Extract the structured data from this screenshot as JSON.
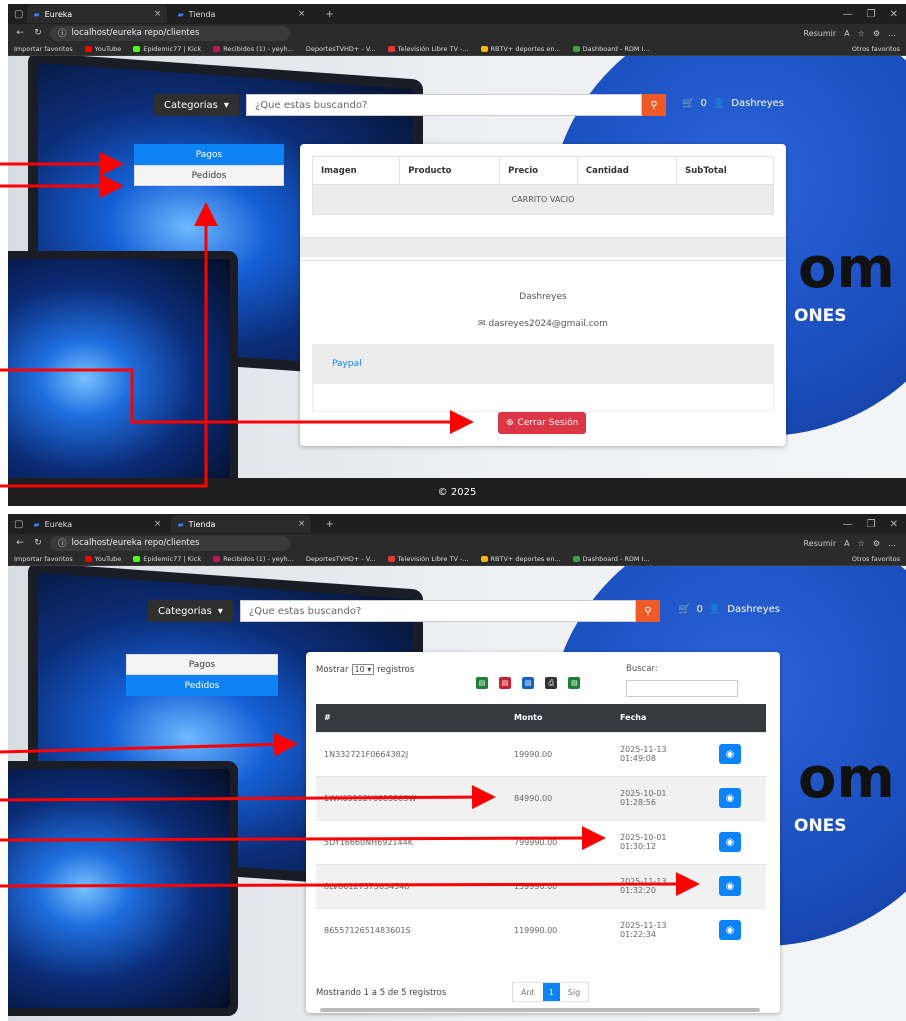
{
  "browser": {
    "tabs": [
      "Eureka",
      "Tienda"
    ],
    "url": "localhost/eureka repo/clientes",
    "toolbar_text": "Resumir",
    "bookmarks": [
      "Importar favoritos",
      "YouTube",
      "Epidemic77 | Kick",
      "Recibidos (1) - yeyh...",
      "DeportesTVHD+ - V...",
      "Televisión Libre TV -...",
      "RBTV+ deportes en...",
      "Dashboard - RDM I..."
    ],
    "other_favorites": "Otros favoritos"
  },
  "header": {
    "categories": "Categorias",
    "search_placeholder": "¿Que estas buscando?",
    "cart_count": "0",
    "username": "Dashreyes"
  },
  "menu": {
    "pagos": "Pagos",
    "pedidos": "Pedidos"
  },
  "background_text": {
    "com": "om",
    "sub": "ONES"
  },
  "cart": {
    "columns": [
      "Imagen",
      "Producto",
      "Precio",
      "Cantidad",
      "SubTotal"
    ],
    "empty": "CARRITO VACIO"
  },
  "profile": {
    "name": "Dashreyes",
    "email": "dasreyes2024@gmail.com",
    "payment": "Paypal",
    "logout": "Cerrar Sesión"
  },
  "footer": "© 2025",
  "orders": {
    "show_prefix": "Mostrar",
    "show_value": "10",
    "show_suffix": "registros",
    "search_label": "Buscar:",
    "columns": [
      "#",
      "Monto",
      "Fecha",
      ""
    ],
    "rows": [
      {
        "id": "1N332721F0664382J",
        "monto": "19990.00",
        "fecha1": "2025-11-13",
        "fecha2": "01:49:08"
      },
      {
        "id": "1WX65152Y6083803W",
        "monto": "84990.00",
        "fecha1": "2025-10-01",
        "fecha2": "01:28:56"
      },
      {
        "id": "5DY16660NH692144K",
        "monto": "799990.00",
        "fecha1": "2025-10-01",
        "fecha2": "01:30:12"
      },
      {
        "id": "8LV86127373634548",
        "monto": "139990.00",
        "fecha1": "2025-11-13",
        "fecha2": "01:32:20"
      },
      {
        "id": "8655712651483601S",
        "monto": "119990.00",
        "fecha1": "2025-11-13",
        "fecha2": "01:22:34"
      }
    ],
    "info": "Mostrando 1 a 5 de 5 registros",
    "prev": "Ant",
    "page": "1",
    "next": "Sig"
  },
  "colors": {
    "accent": "#0d83f5",
    "danger": "#dc3545",
    "orange": "#f05a28",
    "arrow": "#ff0000"
  }
}
